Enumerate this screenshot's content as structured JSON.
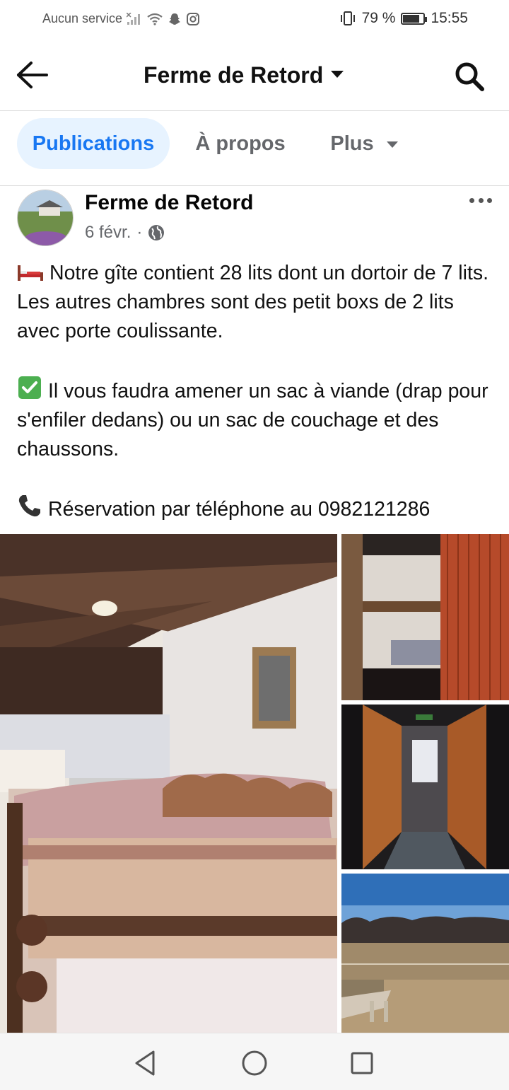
{
  "status_bar": {
    "carrier": "Aucun service",
    "battery_percent": "79 %",
    "battery_level": 0.79,
    "time": "15:55"
  },
  "header": {
    "title": "Ferme de Retord",
    "back_icon": "arrow-left-icon",
    "search_icon": "search-icon"
  },
  "tabs": [
    {
      "label": "Publications",
      "active": true
    },
    {
      "label": "À propos",
      "active": false
    },
    {
      "label": "Plus",
      "active": false
    }
  ],
  "post": {
    "author": "Ferme de Retord",
    "date": "6 févr.",
    "separator": "·",
    "audience_icon": "globe-icon",
    "paragraphs": [
      {
        "icon": "bed-icon",
        "text": "Notre gîte contient 28 lits dont un dortoir de 7 lits. Les autres chambres sont des petit boxs de 2 lits avec porte coulissante."
      },
      {
        "icon": "check-box-icon",
        "text": "Il vous faudra amener un sac à viande (drap pour s'enfiler dedans) ou un sac de couchage et des chaussons."
      },
      {
        "icon": "phone-icon",
        "text": "Réservation par téléphone au 0982121286"
      }
    ]
  },
  "photos": [
    {
      "name": "dormitory-photo"
    },
    {
      "name": "bunk-room-photo"
    },
    {
      "name": "corridor-photo"
    },
    {
      "name": "landscape-photo"
    }
  ],
  "colors": {
    "accent": "#1877f2",
    "tab_active_bg": "#e7f3ff",
    "secondary_text": "#65676b"
  },
  "navbar": {
    "back": "triangle-back-icon",
    "home": "circle-home-icon",
    "recents": "square-recents-icon"
  }
}
